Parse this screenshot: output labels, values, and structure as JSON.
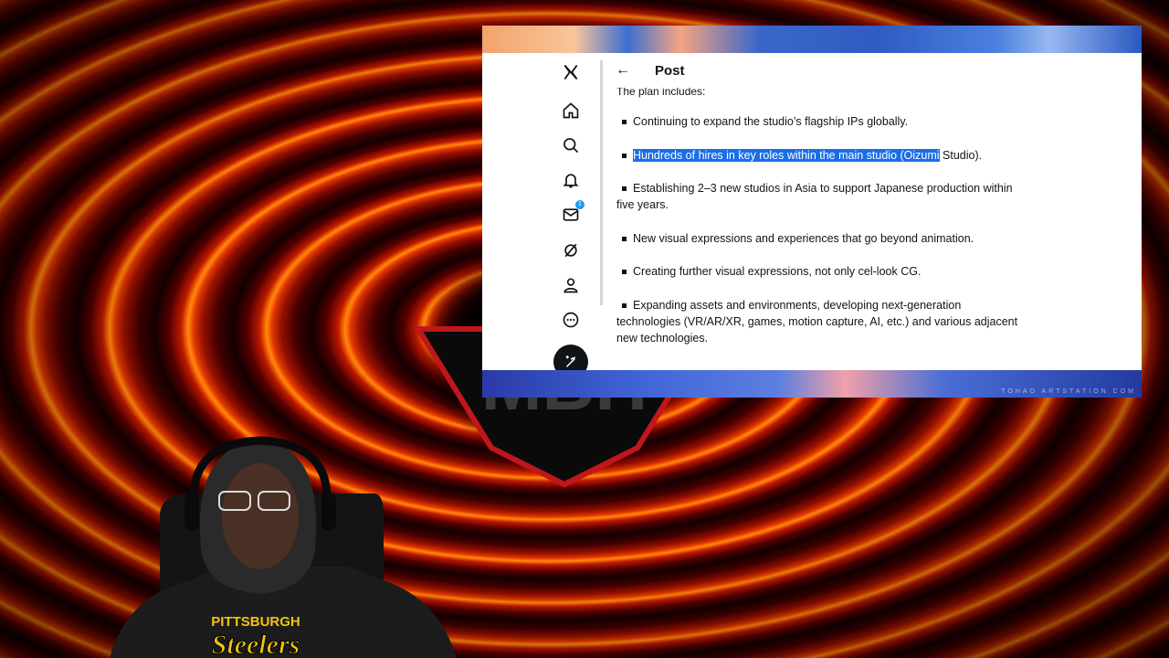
{
  "browser": {
    "header": {
      "title": "Post"
    },
    "nav": {
      "message_badge": "1"
    },
    "post": {
      "partial_top_line": "The plan includes:",
      "items": [
        {
          "text": "Continuing to expand the studio’s flagship IPs globally."
        },
        {
          "highlighted": "Hundreds of hires in key roles within the main studio (Oizumi",
          "rest": " Studio)."
        },
        {
          "text": "Establishing 2–3 new studios in Asia to support Japanese production within five years."
        },
        {
          "text": "New visual expressions and experiences that go beyond animation."
        },
        {
          "text": "Creating further visual expressions, not only cel-look CG."
        },
        {
          "text": "Expanding assets and environments, developing next-generation technologies (VR/AR/XR, games, motion capture, AI, etc.) and various adjacent new technologies."
        }
      ]
    },
    "watermark": "TOHAO ARTSTATION COM"
  },
  "overlay": {
    "logo_text": "MBH",
    "shirt_top": "PITTSBURGH",
    "shirt_main": "Steelers"
  },
  "colors": {
    "highlight": "#1a6ee8",
    "badge": "#1d9bf0",
    "text": "#0f1419"
  }
}
